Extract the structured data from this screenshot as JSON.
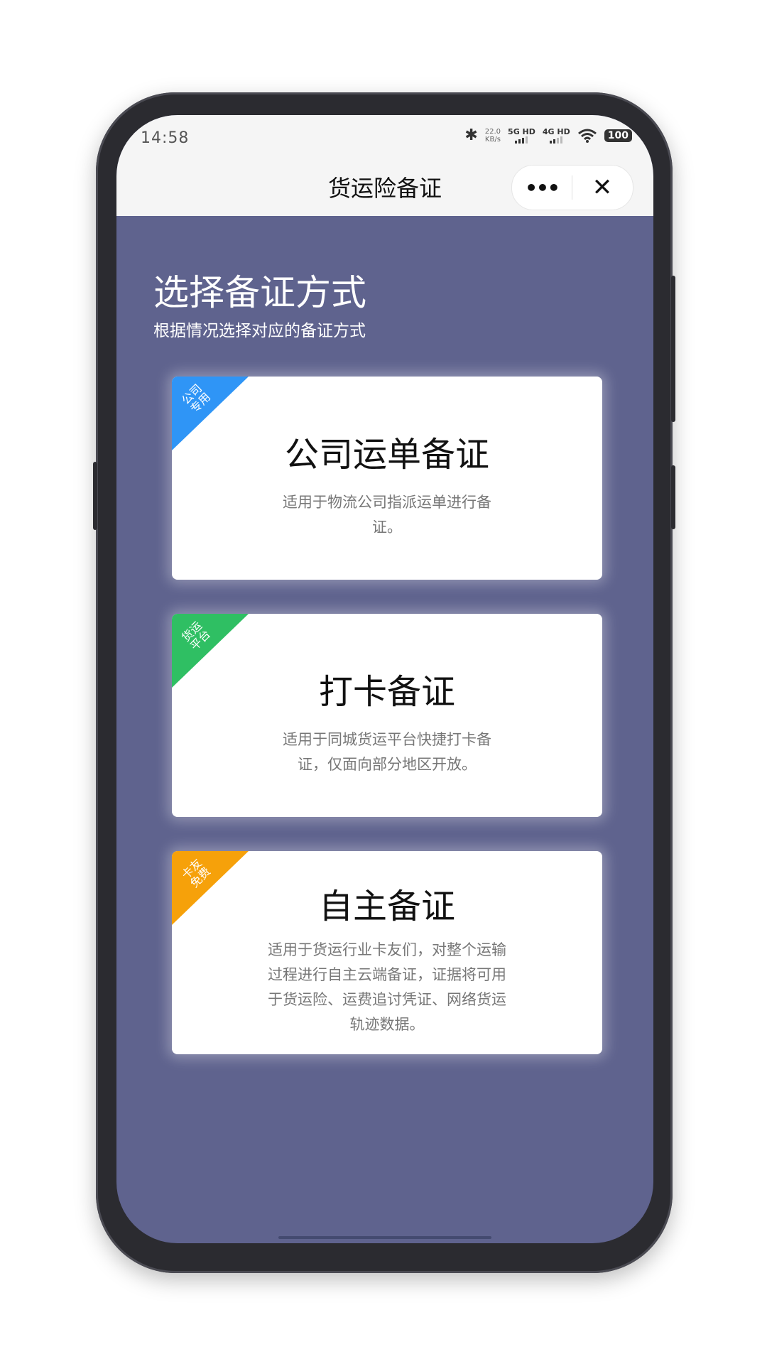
{
  "status_bar": {
    "time": "14:58",
    "speed_value": "22.0",
    "speed_unit": "KB/s",
    "network_1": "5G HD",
    "network_2": "4G HD",
    "battery": "100"
  },
  "nav": {
    "title": "货运险备证",
    "more_label": "•••",
    "close_label": "✕"
  },
  "main": {
    "title": "选择备证方式",
    "subtitle": "根据情况选择对应的备证方式",
    "cards": [
      {
        "tag_line1": "公司",
        "tag_line2": "专用",
        "tag_color": "#2f95f6",
        "title": "公司运单备证",
        "description": "适用于物流公司指派运单进行备证。"
      },
      {
        "tag_line1": "货运",
        "tag_line2": "平台",
        "tag_color": "#2fbf63",
        "title": "打卡备证",
        "description": "适用于同城货运平台快捷打卡备证，仅面向部分地区开放。"
      },
      {
        "tag_line1": "卡友",
        "tag_line2": "免费",
        "tag_color": "#f6a10a",
        "title": "自主备证",
        "description": "适用于货运行业卡友们，对整个运输过程进行自主云端备证，证据将可用于货运险、运费追讨凭证、网络货运轨迹数据。"
      }
    ]
  },
  "colors": {
    "background": "#5f638e",
    "topbar": "#f5f5f5"
  }
}
